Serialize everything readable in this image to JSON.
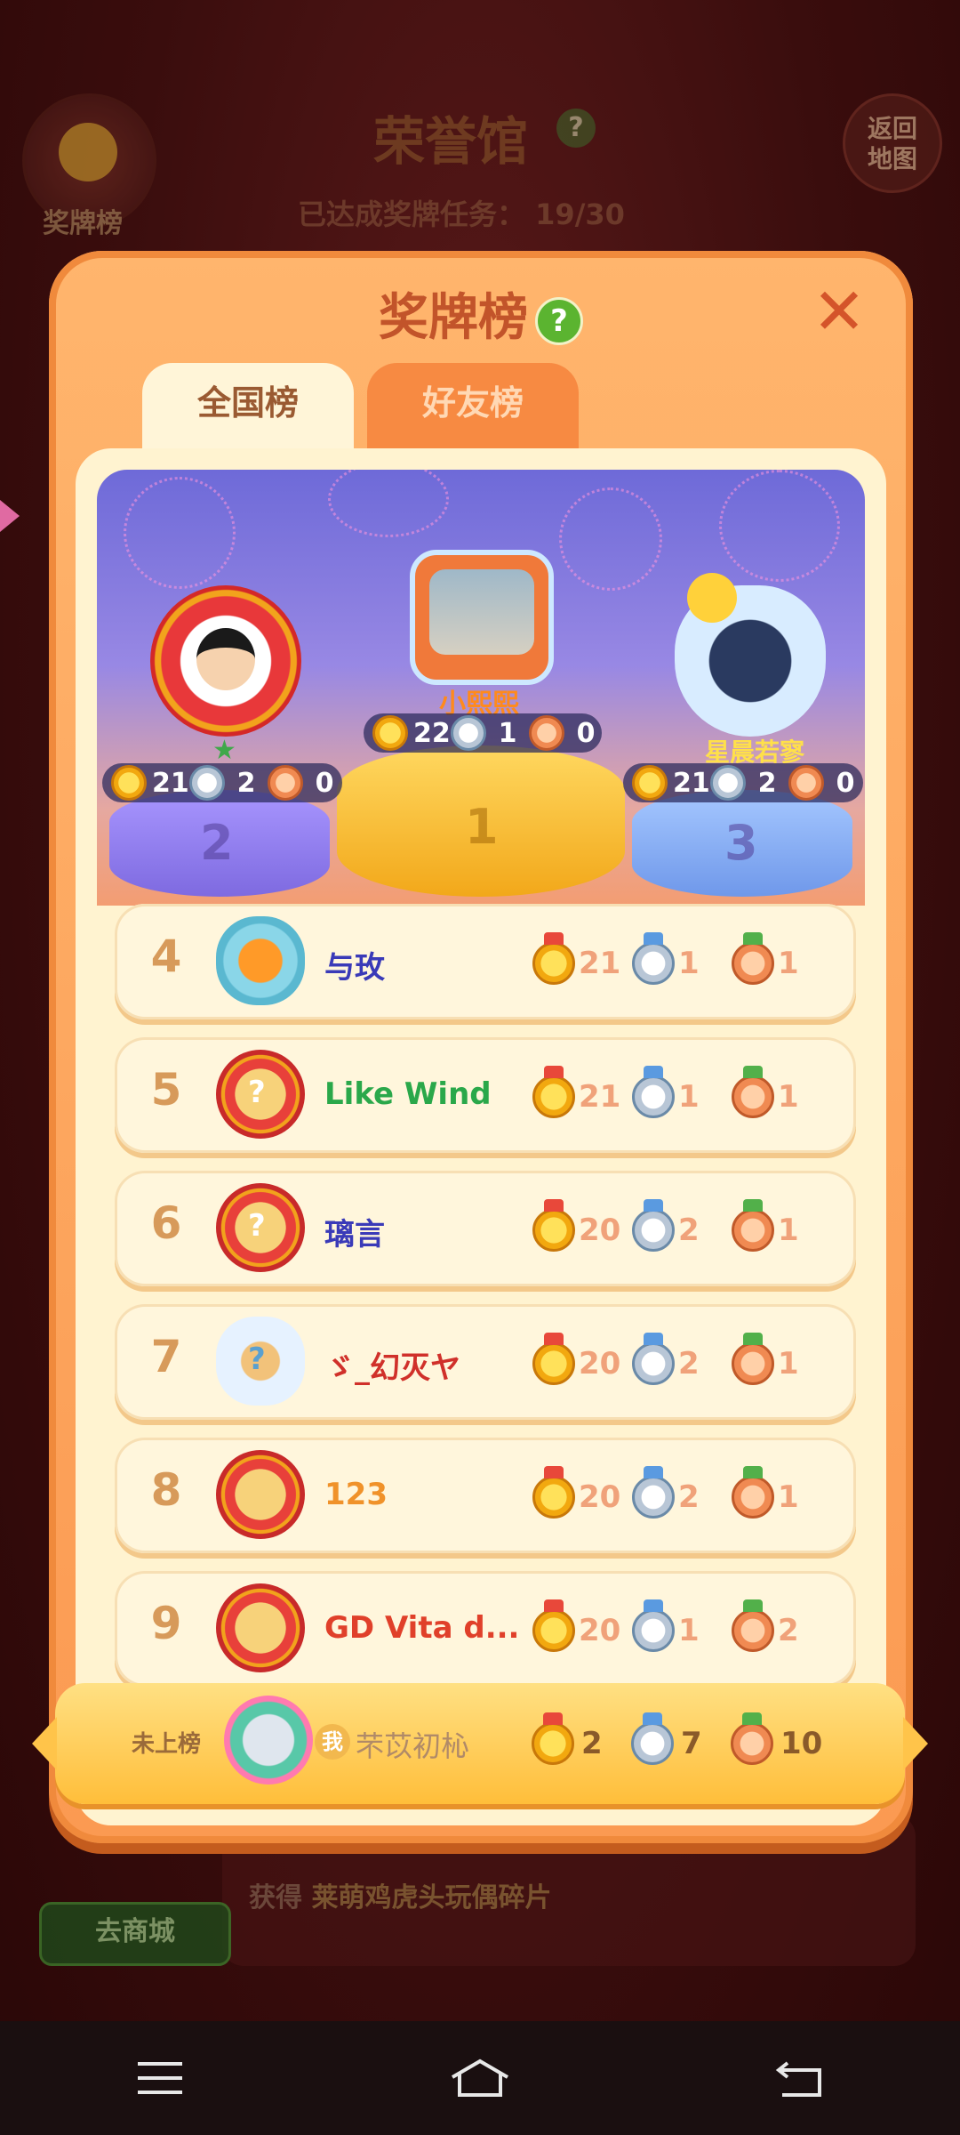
{
  "background": {
    "hall_title": "荣誉馆",
    "help_glyph": "?",
    "medal_board_label": "奖牌榜",
    "back_map_label": "返回\n地图",
    "task_progress_label": "已达成奖牌任务：",
    "task_progress_value": "19/30",
    "shop_button": "去商城",
    "reward_prefix": "获得",
    "reward_item": "莱萌鸡虎头玩偶碎片"
  },
  "modal": {
    "title": "奖牌榜",
    "help_glyph": "?",
    "close_glyph": "✕",
    "tabs": [
      {
        "label": "全国榜",
        "active": true
      },
      {
        "label": "好友榜",
        "active": false
      }
    ]
  },
  "podium": {
    "first": {
      "rank": "1",
      "name": "小熙熙",
      "gold": "22",
      "silver": "1",
      "bronze": "0"
    },
    "second": {
      "rank": "2",
      "name": "",
      "gold": "21",
      "silver": "2",
      "bronze": "0"
    },
    "third": {
      "rank": "3",
      "name": "星晨若寥",
      "gold": "21",
      "silver": "2",
      "bronze": "0"
    }
  },
  "ranking": [
    {
      "rank": "4",
      "name": "与玫",
      "name_color": "#3a3ab8",
      "gold": "21",
      "silver": "1",
      "bronze": "1"
    },
    {
      "rank": "5",
      "name": "Like  Wind",
      "name_color": "#2aa84a",
      "gold": "21",
      "silver": "1",
      "bronze": "1"
    },
    {
      "rank": "6",
      "name": "璃言",
      "name_color": "#3a3ab8",
      "gold": "20",
      "silver": "2",
      "bronze": "1"
    },
    {
      "rank": "7",
      "name": "ゞ_幻灭ヤ",
      "name_color": "#d0302a",
      "gold": "20",
      "silver": "2",
      "bronze": "1"
    },
    {
      "rank": "8",
      "name": "123",
      "name_color": "#f0922a",
      "gold": "20",
      "silver": "2",
      "bronze": "1"
    },
    {
      "rank": "9",
      "name": "GD Vita d...",
      "name_color": "#e0402a",
      "gold": "20",
      "silver": "1",
      "bronze": "2"
    }
  ],
  "self": {
    "status": "未上榜",
    "tag": "我",
    "name": "芣苡初杺",
    "gold": "2",
    "silver": "7",
    "bronze": "10"
  },
  "navbar": {
    "icons": [
      "menu-icon",
      "home-icon",
      "back-icon"
    ]
  }
}
